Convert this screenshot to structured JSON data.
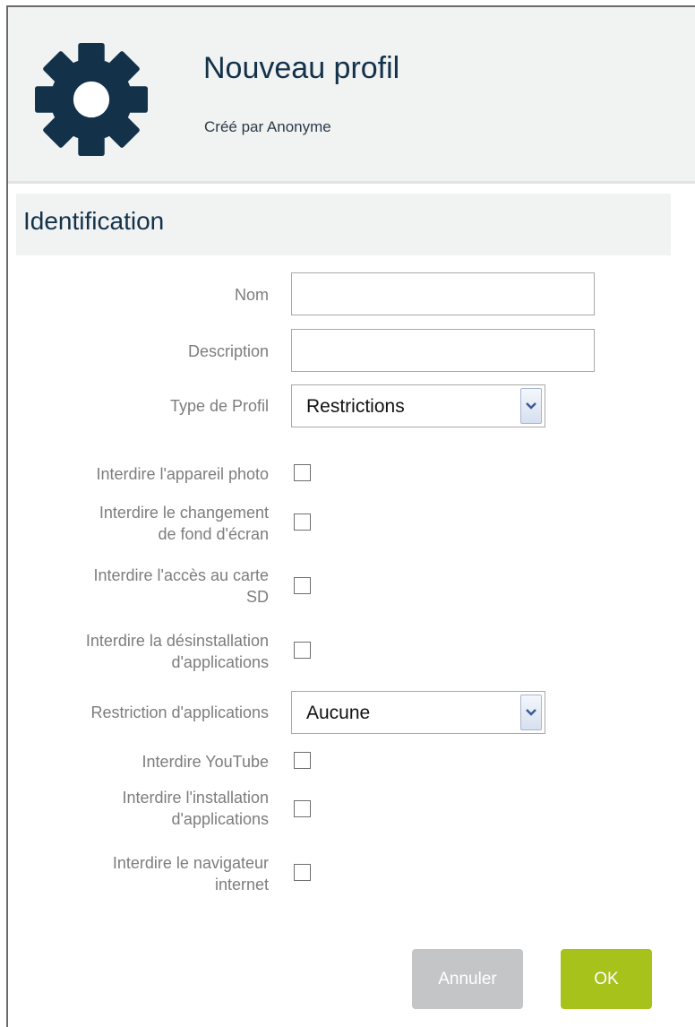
{
  "header": {
    "title": "Nouveau profil",
    "subtitle": "Créé par Anonyme",
    "icon": "gear-icon",
    "icon_color": "#13324a"
  },
  "section": {
    "title": "Identification"
  },
  "form": {
    "name_label": "Nom",
    "name_value": "",
    "description_label": "Description",
    "description_value": "",
    "profile_type_label": "Type de Profil",
    "profile_type_value": "Restrictions",
    "camera_label_1": "Interdire l'appareil photo",
    "wallpaper_label_1": "Interdire le changement",
    "wallpaper_label_2": "de fond d'écran",
    "sdcard_label_1": "Interdire l'accès au carte",
    "sdcard_label_2": "SD",
    "uninstall_label_1": "Interdire la désinstallation",
    "uninstall_label_2": "d'applications",
    "app_restriction_label": "Restriction d'applications",
    "app_restriction_value": "Aucune",
    "youtube_label_1": "Interdire YouTube",
    "install_label_1": "Interdire l'installation",
    "install_label_2": "d'applications",
    "browser_label_1": "Interdire le navigateur",
    "browser_label_2": "internet"
  },
  "checkboxes": {
    "camera": false,
    "wallpaper": false,
    "sdcard": false,
    "uninstall": false,
    "youtube": false,
    "install": false,
    "browser": false
  },
  "buttons": {
    "cancel_label": "Annuler",
    "ok_label": "OK"
  },
  "colors": {
    "accent_green": "#a8c21c",
    "cancel_gray": "#c3c5c7",
    "header_bg": "#f1f2f2",
    "title_navy": "#13324a",
    "label_gray": "#7d7d7d"
  }
}
